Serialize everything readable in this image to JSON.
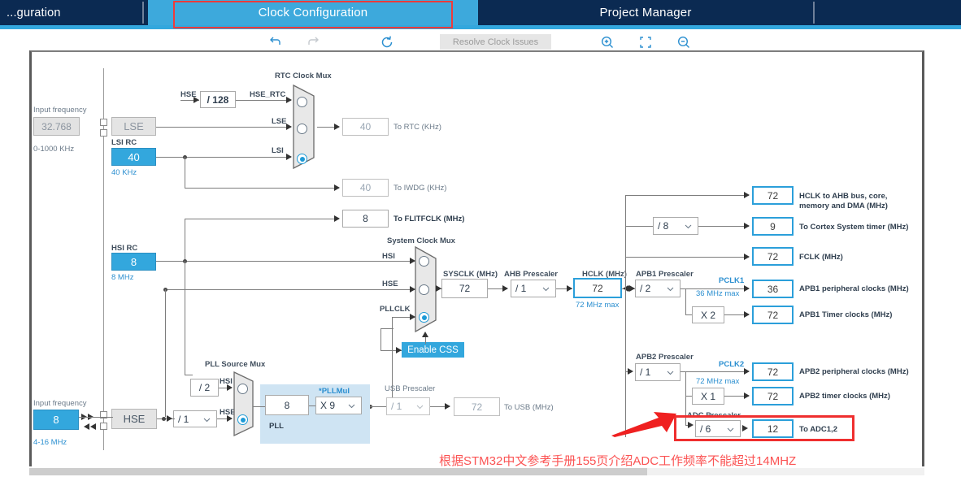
{
  "app": {
    "tabs": [
      {
        "label": "...guration",
        "state": "inactive"
      },
      {
        "label": "Clock Configuration",
        "state": "active"
      },
      {
        "label": "Project Manager",
        "state": "inactive"
      }
    ],
    "selection_outline_color": "#ef3b3b"
  },
  "toolbar": {
    "undo": "undo-icon",
    "redo": "redo-icon",
    "refresh": "refresh-icon",
    "resolve_label": "Resolve Clock Issues",
    "zoom_in": "zoom-in-icon",
    "fit": "fit-to-screen-icon",
    "zoom_out": "zoom-out-icon"
  },
  "diagram": {
    "lse": {
      "input_freq_label": "Input frequency",
      "input_freq_value": "32.768",
      "range": "0-1000 KHz",
      "name": "LSE"
    },
    "lsi": {
      "title": "LSI RC",
      "value": "40",
      "unit": "40 KHz"
    },
    "hsi": {
      "title": "HSI RC",
      "value": "8",
      "unit": "8 MHz"
    },
    "hse": {
      "input_freq_label": "Input frequency",
      "input_freq_value": "8",
      "range": "4-16 MHz",
      "name": "HSE",
      "divider": "/ 1"
    },
    "rtc_mux": {
      "title": "RTC Clock Mux",
      "in_hse": "HSE",
      "hse_div": "/ 128",
      "in_hse_rtc": "HSE_RTC",
      "in_lse": "LSE",
      "in_lsi": "LSI",
      "selected": "LSI"
    },
    "outputs": {
      "to_rtc": {
        "value": "40",
        "label": "To RTC (KHz)"
      },
      "to_iwdg": {
        "value": "40",
        "label": "To IWDG (KHz)"
      },
      "to_flitfclk": {
        "value": "8",
        "label": "To FLITFCLK (MHz)"
      }
    },
    "system_clock_mux": {
      "title": "System Clock Mux",
      "in_hsi": "HSI",
      "in_hse": "HSE",
      "in_pllclk": "PLLCLK",
      "selected": "PLLCLK",
      "enable_css": "Enable CSS"
    },
    "sysclk": {
      "label": "SYSCLK (MHz)",
      "value": "72"
    },
    "ahb_prescaler": {
      "label": "AHB Prescaler",
      "value": "/ 1"
    },
    "hclk": {
      "label": "HCLK (MHz)",
      "value": "72",
      "max": "72 MHz max"
    },
    "pll": {
      "source_mux_title": "PLL Source Mux",
      "hsi_div": "/ 2",
      "in_hsi": "HSI",
      "in_hse": "HSE",
      "selected": "HSE",
      "panel_label": "PLL",
      "input_value": "8",
      "pllmul_label": "*PLLMul",
      "pllmul_value": "X 9"
    },
    "usb": {
      "prescaler_label": "USB Prescaler",
      "prescaler_value": "/ 1",
      "value": "72",
      "label": "To USB (MHz)"
    },
    "hclk_outputs": [
      {
        "value": "72",
        "label": "HCLK to AHB bus, core,\nmemory and DMA (MHz)"
      },
      {
        "prescaler": "/ 8",
        "value": "9",
        "label": "To Cortex System timer (MHz)"
      },
      {
        "value": "72",
        "label": "FCLK (MHz)"
      }
    ],
    "hclk_out_0_line1": "HCLK to AHB bus, core,",
    "hclk_out_0_line2": "memory and DMA (MHz)",
    "cortex_timer_prescaler": "/ 8",
    "cortex_timer_value": "9",
    "cortex_timer_label": "To Cortex System timer (MHz)",
    "hclk_ahb_value": "72",
    "fclk_value": "72",
    "fclk_label": "FCLK (MHz)",
    "apb1": {
      "prescaler_label": "APB1 Prescaler",
      "prescaler_value": "/ 2",
      "pclk_label": "PCLK1",
      "max": "36 MHz max",
      "periph_value": "36",
      "periph_label": "APB1 peripheral clocks (MHz)",
      "timer_mul": "X 2",
      "timer_value": "72",
      "timer_label": "APB1 Timer clocks (MHz)"
    },
    "apb2": {
      "prescaler_label": "APB2 Prescaler",
      "prescaler_value": "/ 1",
      "pclk_label": "PCLK2",
      "max": "72 MHz max",
      "periph_value": "72",
      "periph_label": "APB2 peripheral clocks (MHz)",
      "timer_mul": "X 1",
      "timer_value": "72",
      "timer_label": "APB2 timer clocks (MHz)"
    },
    "adc": {
      "prescaler_label": "ADC Prescaler",
      "prescaler_value": "/ 6",
      "value": "12",
      "label": "To ADC1,2"
    }
  },
  "annotation": {
    "note": "根据STM32中文参考手册155页介绍ADC工作频率不能超过14MHZ",
    "color": "#fb5353"
  },
  "colors": {
    "accent_blue": "#33a7dd",
    "tab_navy": "#0b2a52",
    "highlight_red": "#ef2f2f",
    "panel_blue": "#cfe4f3"
  }
}
